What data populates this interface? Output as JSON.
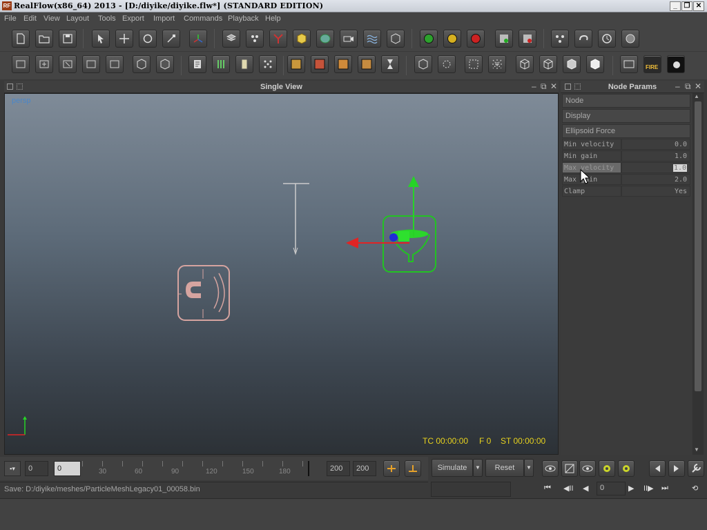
{
  "window": {
    "title": "RealFlow(x86_64) 2013 - [D:/diyike/diyike.flw*] (STANDARD EDITION)",
    "app_icon_label": "RF",
    "min_label": "_",
    "max_label": "❐",
    "close_label": "✕"
  },
  "menu": [
    "File",
    "Edit",
    "View",
    "Layout",
    "Tools",
    "Export",
    "Import",
    "Commands",
    "Playback",
    "Help"
  ],
  "toolbar1": {
    "icons": [
      "new-file-icon",
      "open-file-icon",
      "save-file-icon",
      "select-arrow-icon",
      "move-icon",
      "rotate-icon",
      "scale-icon",
      "axis-icon",
      "object-icon",
      "particles-icon",
      "daemon-icon",
      "cube-icon",
      "mesh-icon",
      "camera-icon",
      "waves-icon",
      "grid-box-icon",
      "sim-green-icon",
      "sim-yellow-icon",
      "sim-red-icon",
      "save-green-icon",
      "save-red-icon",
      "batch-icon",
      "link-icon",
      "timer-icon",
      "brain-icon"
    ]
  },
  "toolbar2": {
    "fire_label": "FIRE"
  },
  "viewport": {
    "title": "Single View",
    "camera_label": "persp",
    "tc": "TC 00:00:00",
    "frame": "F 0",
    "st": "ST 00:00:00"
  },
  "node_params": {
    "title": "Node Params",
    "sections": [
      "Node",
      "Display",
      "Ellipsoid Force"
    ],
    "rows": [
      {
        "key": "Min velocity",
        "value": "0.0"
      },
      {
        "key": "Min gain",
        "value": "1.0"
      },
      {
        "key": "Max velocity",
        "value": "1.0"
      },
      {
        "key": "Max gain",
        "value": "2.0"
      },
      {
        "key": "Clamp",
        "value": "Yes"
      }
    ]
  },
  "timeline": {
    "start": "0",
    "current": "0",
    "ticks": [
      "30",
      "60",
      "90",
      "120",
      "150",
      "180"
    ],
    "end1": "200",
    "end2": "200",
    "simulate_label": "Simulate",
    "reset_label": "Reset",
    "frame_field": "0"
  },
  "status": {
    "message": "Save: D:/diyike/meshes/ParticleMeshLegacy01_00058.bin"
  },
  "colors": {
    "hud": "#e7d21e",
    "selection": "#22c322",
    "daemon": "#d6a4a0"
  }
}
